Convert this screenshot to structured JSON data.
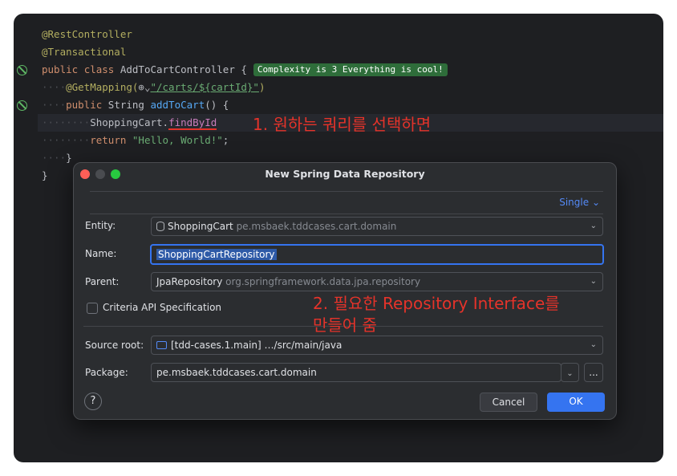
{
  "editor": {
    "lines": {
      "l1": "@RestController",
      "l2": "@Transactional",
      "l3_kw1": "public",
      "l3_kw2": "class",
      "l3_name": "AddToCartController",
      "l3_brace": "{",
      "complexity_badge": "Complexity is 3 Everything is cool!",
      "l4_annotation": "@GetMapping(",
      "l4_url": "\"/carts/${cartId}\"",
      "l4_end": ")",
      "l5_kw": "public",
      "l5_type": "String",
      "l5_method": "addToCart",
      "l5_rest": "() {",
      "l6_class": "ShoppingCart.",
      "l6_method": "findById",
      "l7_kw": "return",
      "l7_str": "\"Hello, World!\"",
      "l7_end": ";",
      "l8": "}",
      "l9": "}"
    },
    "callout_1": "1. 원하는 쿼리를 선택하면",
    "callout_2_line1": "2. 필요한 Repository Interface를",
    "callout_2_line2": "만들어 줌"
  },
  "dialog": {
    "title": "New Spring Data Repository",
    "mode": "Single",
    "entity": {
      "label": "Entity:",
      "value": "ShoppingCart",
      "package": "pe.msbaek.tddcases.cart.domain"
    },
    "name": {
      "label": "Name:",
      "value": "ShoppingCartRepository"
    },
    "parent": {
      "label": "Parent:",
      "value": "JpaRepository",
      "package": "org.springframework.data.jpa.repository"
    },
    "criteria": {
      "label": "Criteria API Specification",
      "checked": false
    },
    "source_root": {
      "label": "Source root:",
      "value": "[tdd-cases.1.main]",
      "path": "…/src/main/java"
    },
    "package": {
      "label": "Package:",
      "value": "pe.msbaek.tddcases.cart.domain"
    },
    "help_label": "?",
    "browse_label": "...",
    "cancel_label": "Cancel",
    "ok_label": "OK"
  },
  "colors": {
    "accent": "#3574f0",
    "callout": "#e5332a",
    "badge": "#2e6d3a"
  }
}
